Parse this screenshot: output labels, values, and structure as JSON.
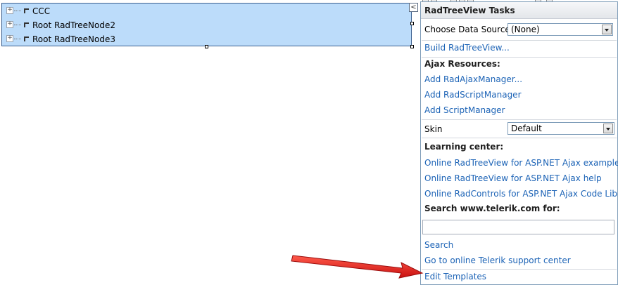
{
  "tree": {
    "nodes": [
      {
        "label": "CCC"
      },
      {
        "label": "Root RadTreeNode2"
      },
      {
        "label": "Root RadTreeNode3"
      }
    ],
    "expander_symbol": "+",
    "smart_tag_symbol": "<"
  },
  "panel": {
    "title": "RadTreeView Tasks",
    "data_source_label": "Choose Data Source:",
    "data_source_value": "(None)",
    "build_link": "Build RadTreeView...",
    "ajax_heading": "Ajax Resources:",
    "ajax_links": [
      "Add RadAjaxManager...",
      "Add RadScriptManager",
      "Add ScriptManager"
    ],
    "skin_label": "Skin",
    "skin_value": "Default",
    "learning_heading": "Learning center:",
    "learning_links": [
      "Online RadTreeView for ASP.NET Ajax examples",
      "Online RadTreeView for ASP.NET Ajax help",
      "Online RadControls for ASP.NET Ajax Code Library"
    ],
    "search_heading": "Search www.telerik.com for:",
    "search_value": "",
    "search_link": "Search",
    "support_link": "Go to online Telerik support center",
    "edit_templates_link": "Edit Templates"
  },
  "colors": {
    "selection_fill": "#bcdcfa",
    "link": "#1c63b6",
    "annotation_arrow": "#e21b1b"
  }
}
